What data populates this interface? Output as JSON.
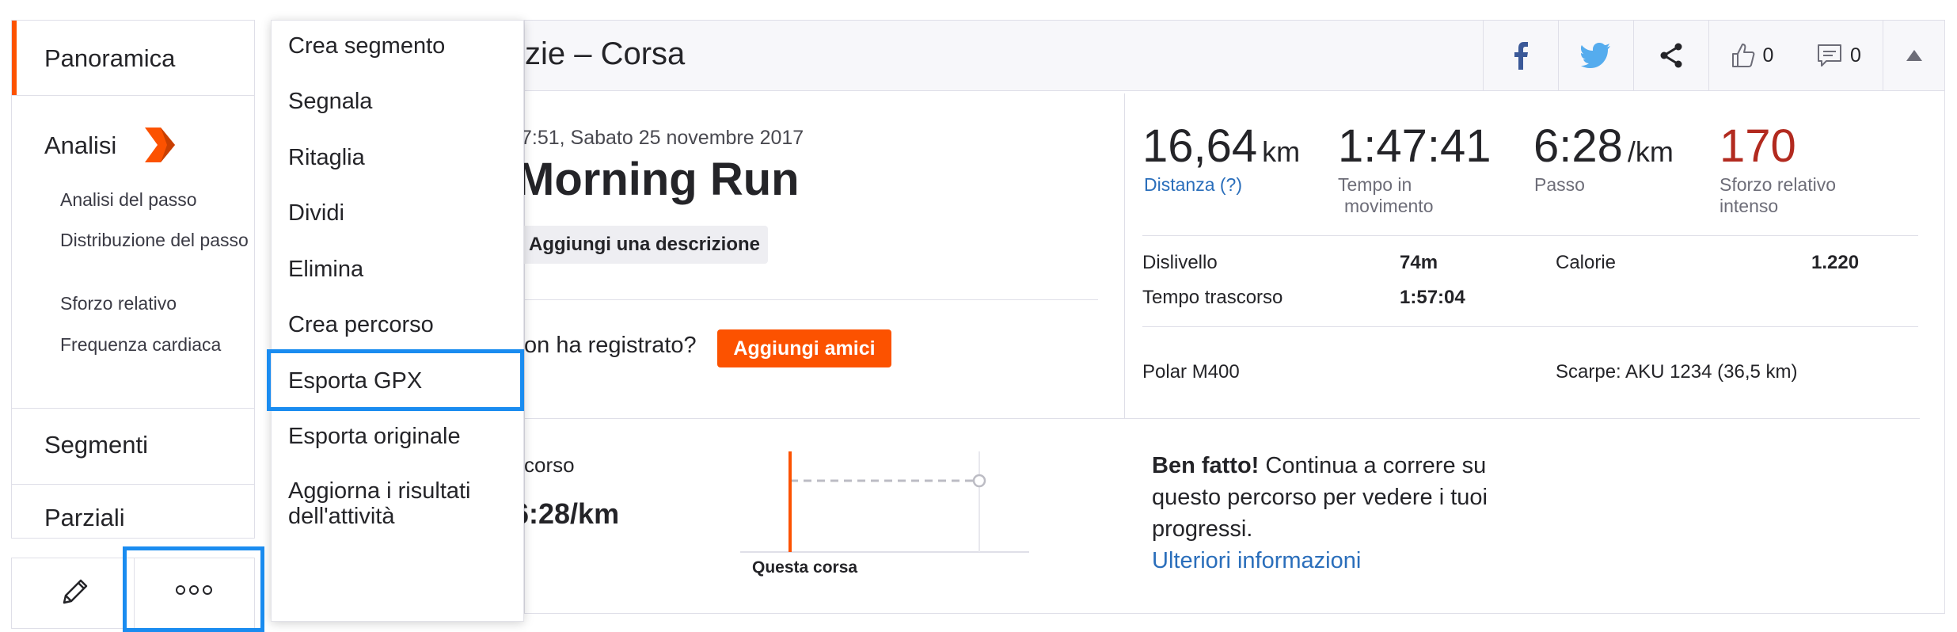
{
  "sidebar": {
    "overview": "Panoramica",
    "analysis": "Analisi",
    "analysis_items": [
      "Analisi del passo",
      "Distribuzione del passo",
      "Sforzo relativo",
      "Frequenza cardiaca"
    ],
    "segments": "Segmenti",
    "splits": "Parziali",
    "accent_color": "#fc5200"
  },
  "menu": {
    "items": [
      "Crea segmento",
      "Segnala",
      "Ritaglia",
      "Dividi",
      "Elimina",
      "Crea percorso",
      "Esporta GPX",
      "Esporta originale",
      "Aggiorna i risultati dell'attività"
    ],
    "highlighted": "Esporta GPX"
  },
  "header": {
    "title": "zie – Corsa",
    "kudos_count": "0",
    "comments_count": "0"
  },
  "activity": {
    "date": "7:51, Sabato 25 novembre 2017",
    "name": "Morning Run",
    "add_description": "Aggiungi una descrizione",
    "who_question": "on ha registrato?",
    "add_friends": "Aggiungi amici"
  },
  "stats": {
    "distance_value": "16,64",
    "distance_unit": "km",
    "distance_label": "Distanza (?)",
    "moving_time_value": "1:47:41",
    "moving_time_label": "Tempo in movimento",
    "pace_value": "6:28",
    "pace_unit": "/km",
    "pace_label": "Passo",
    "effort_value": "170",
    "effort_label": "Sforzo relativo intenso",
    "effort_color": "#b22a1f",
    "elevation_label": "Dislivello",
    "elevation_value": "74m",
    "elapsed_label": "Tempo trascorso",
    "elapsed_value": "1:57:04",
    "calories_label": "Calorie",
    "calories_value": "1.220",
    "device": "Polar M400",
    "shoes": "Scarpe: AKU 1234 (36,5 km)"
  },
  "route": {
    "label": "corso",
    "pace": "6:28/km",
    "chart_caption": "Questa corsa",
    "well_done_bold": "Ben fatto!",
    "well_done_text": " Continua a correre su questo percorso per vedere i tuoi progressi.",
    "more_info": "Ulteriori informazioni"
  }
}
